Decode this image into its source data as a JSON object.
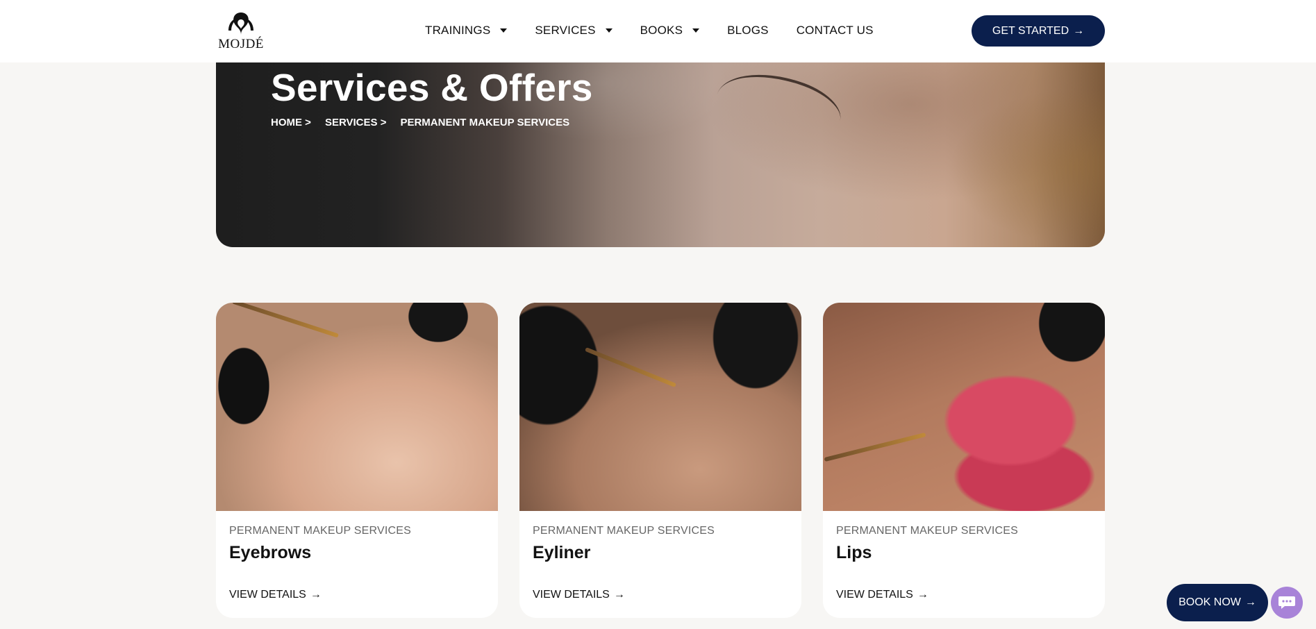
{
  "header": {
    "logo_text": "MOJDÉ",
    "nav": [
      {
        "label": "TRAININGS",
        "has_dropdown": true
      },
      {
        "label": "SERVICES",
        "has_dropdown": true
      },
      {
        "label": "BOOKS",
        "has_dropdown": true
      },
      {
        "label": "BLOGS",
        "has_dropdown": false
      },
      {
        "label": "CONTACT US",
        "has_dropdown": false
      }
    ],
    "cta_label": "GET STARTED"
  },
  "hero": {
    "title": "Services & Offers",
    "breadcrumb": [
      "HOME >",
      "SERVICES >",
      "PERMANENT MAKEUP SERVICES"
    ]
  },
  "cards": [
    {
      "category": "PERMANENT MAKEUP SERVICES",
      "title": "Eyebrows",
      "link": "VIEW DETAILS"
    },
    {
      "category": "PERMANENT MAKEUP SERVICES",
      "title": "Eyliner",
      "link": "VIEW DETAILS"
    },
    {
      "category": "PERMANENT MAKEUP SERVICES",
      "title": "Lips",
      "link": "VIEW DETAILS"
    }
  ],
  "floating": {
    "book_now": "BOOK NOW"
  },
  "colors": {
    "primary": "#0b1f4d",
    "chat": "#a883d8",
    "page_bg": "#f7f6f4"
  },
  "icons": {
    "arrow": "→",
    "chat": "chat-bubble-icon"
  }
}
